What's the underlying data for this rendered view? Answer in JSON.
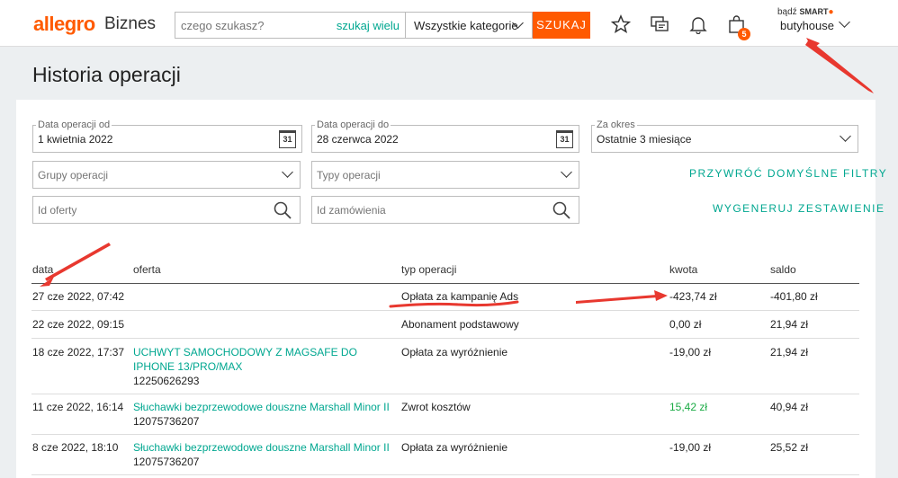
{
  "header": {
    "logo_text": "allegro",
    "logo_suffix": "Biznes",
    "search_placeholder": "czego szukasz?",
    "search_multi": "szukaj wielu",
    "category": "Wszystkie kategorie",
    "search_button": "SZUKAJ",
    "cart_count": "5",
    "smart_prefix": "bądź",
    "smart_label": "SMART",
    "username": "butyhouse"
  },
  "page": {
    "title": "Historia operacji"
  },
  "filters": {
    "date_from": {
      "label": "Data operacji od",
      "value": "1 kwietnia 2022",
      "cal": "31"
    },
    "date_to": {
      "label": "Data operacji do",
      "value": "28 czerwca 2022",
      "cal": "31"
    },
    "period": {
      "label": "Za okres",
      "value": "Ostatnie 3 miesiące"
    },
    "groups_placeholder": "Grupy operacji",
    "types_placeholder": "Typy operacji",
    "offer_id_placeholder": "Id oferty",
    "order_id_placeholder": "Id zamówienia",
    "reset_label": "PRZYWRÓĆ DOMYŚLNE FILTRY",
    "generate_label": "WYGENERUJ ZESTAWIENIE"
  },
  "table": {
    "headers": {
      "date": "data",
      "offer": "oferta",
      "type": "typ operacji",
      "amount": "kwota",
      "balance": "saldo"
    },
    "rows": [
      {
        "date": "27 cze 2022, 07:42",
        "offer_title": "",
        "offer_id": "",
        "type": "Opłata za kampanię Ads",
        "amount": "-423,74 zł",
        "balance": "-401,80 zł"
      },
      {
        "date": "22 cze 2022, 09:15",
        "offer_title": "",
        "offer_id": "",
        "type": "Abonament podstawowy",
        "amount": "0,00 zł",
        "balance": "21,94 zł"
      },
      {
        "date": "18 cze 2022, 17:37",
        "offer_title": "UCHWYT SAMOCHODOWY Z MAGSAFE DO IPHONE 13/PRO/MAX",
        "offer_id": "12250626293",
        "type": "Opłata za wyróżnienie",
        "amount": "-19,00 zł",
        "balance": "21,94 zł"
      },
      {
        "date": "11 cze 2022, 16:14",
        "offer_title": "Słuchawki bezprzewodowe douszne Marshall Minor II",
        "offer_id": "12075736207",
        "type": "Zwrot kosztów",
        "amount": "15,42 zł",
        "balance": "40,94 zł"
      },
      {
        "date": "8 cze 2022, 18:10",
        "offer_title": "Słuchawki bezprzewodowe douszne Marshall Minor II",
        "offer_id": "12075736207",
        "type": "Opłata za wyróżnienie",
        "amount": "-19,00 zł",
        "balance": "25,52 zł"
      }
    ]
  },
  "colors": {
    "accent": "#ff5a00",
    "link": "#00a790",
    "positive": "#1bab45",
    "annotation": "#e8382f"
  }
}
